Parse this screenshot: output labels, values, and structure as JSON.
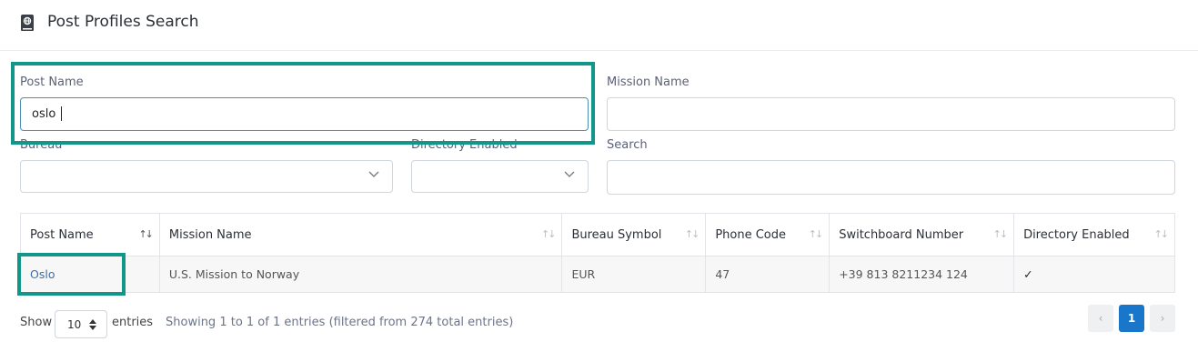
{
  "header": {
    "title": "Post Profiles Search",
    "icon": "book-globe-icon"
  },
  "form": {
    "post_name": {
      "label": "Post Name",
      "value": "oslo"
    },
    "mission_name": {
      "label": "Mission Name",
      "value": ""
    },
    "bureau": {
      "label": "Bureau",
      "value": ""
    },
    "directory_enabled": {
      "label": "Directory Enabled",
      "value": ""
    },
    "search": {
      "label": "Search",
      "value": ""
    }
  },
  "table": {
    "columns": [
      "Post Name",
      "Mission Name",
      "Bureau Symbol",
      "Phone Code",
      "Switchboard Number",
      "Directory Enabled"
    ],
    "rows": [
      {
        "post_name": "Oslo",
        "mission_name": "U.S. Mission to Norway",
        "bureau_symbol": "EUR",
        "phone_code": "47",
        "switchboard_number": "+39 813 8211234 124",
        "directory_enabled": "✓"
      }
    ]
  },
  "footer": {
    "show_label": "Show",
    "page_size": "10",
    "entries_label": "entries",
    "info": "Showing 1 to 1 of 1 entries (filtered from 274 total entries)",
    "pagination": {
      "prev": "‹",
      "current": "1",
      "next": "›"
    }
  },
  "colors": {
    "highlight": "#13968a",
    "primary": "#1976c9",
    "link": "#3f6fa8"
  }
}
